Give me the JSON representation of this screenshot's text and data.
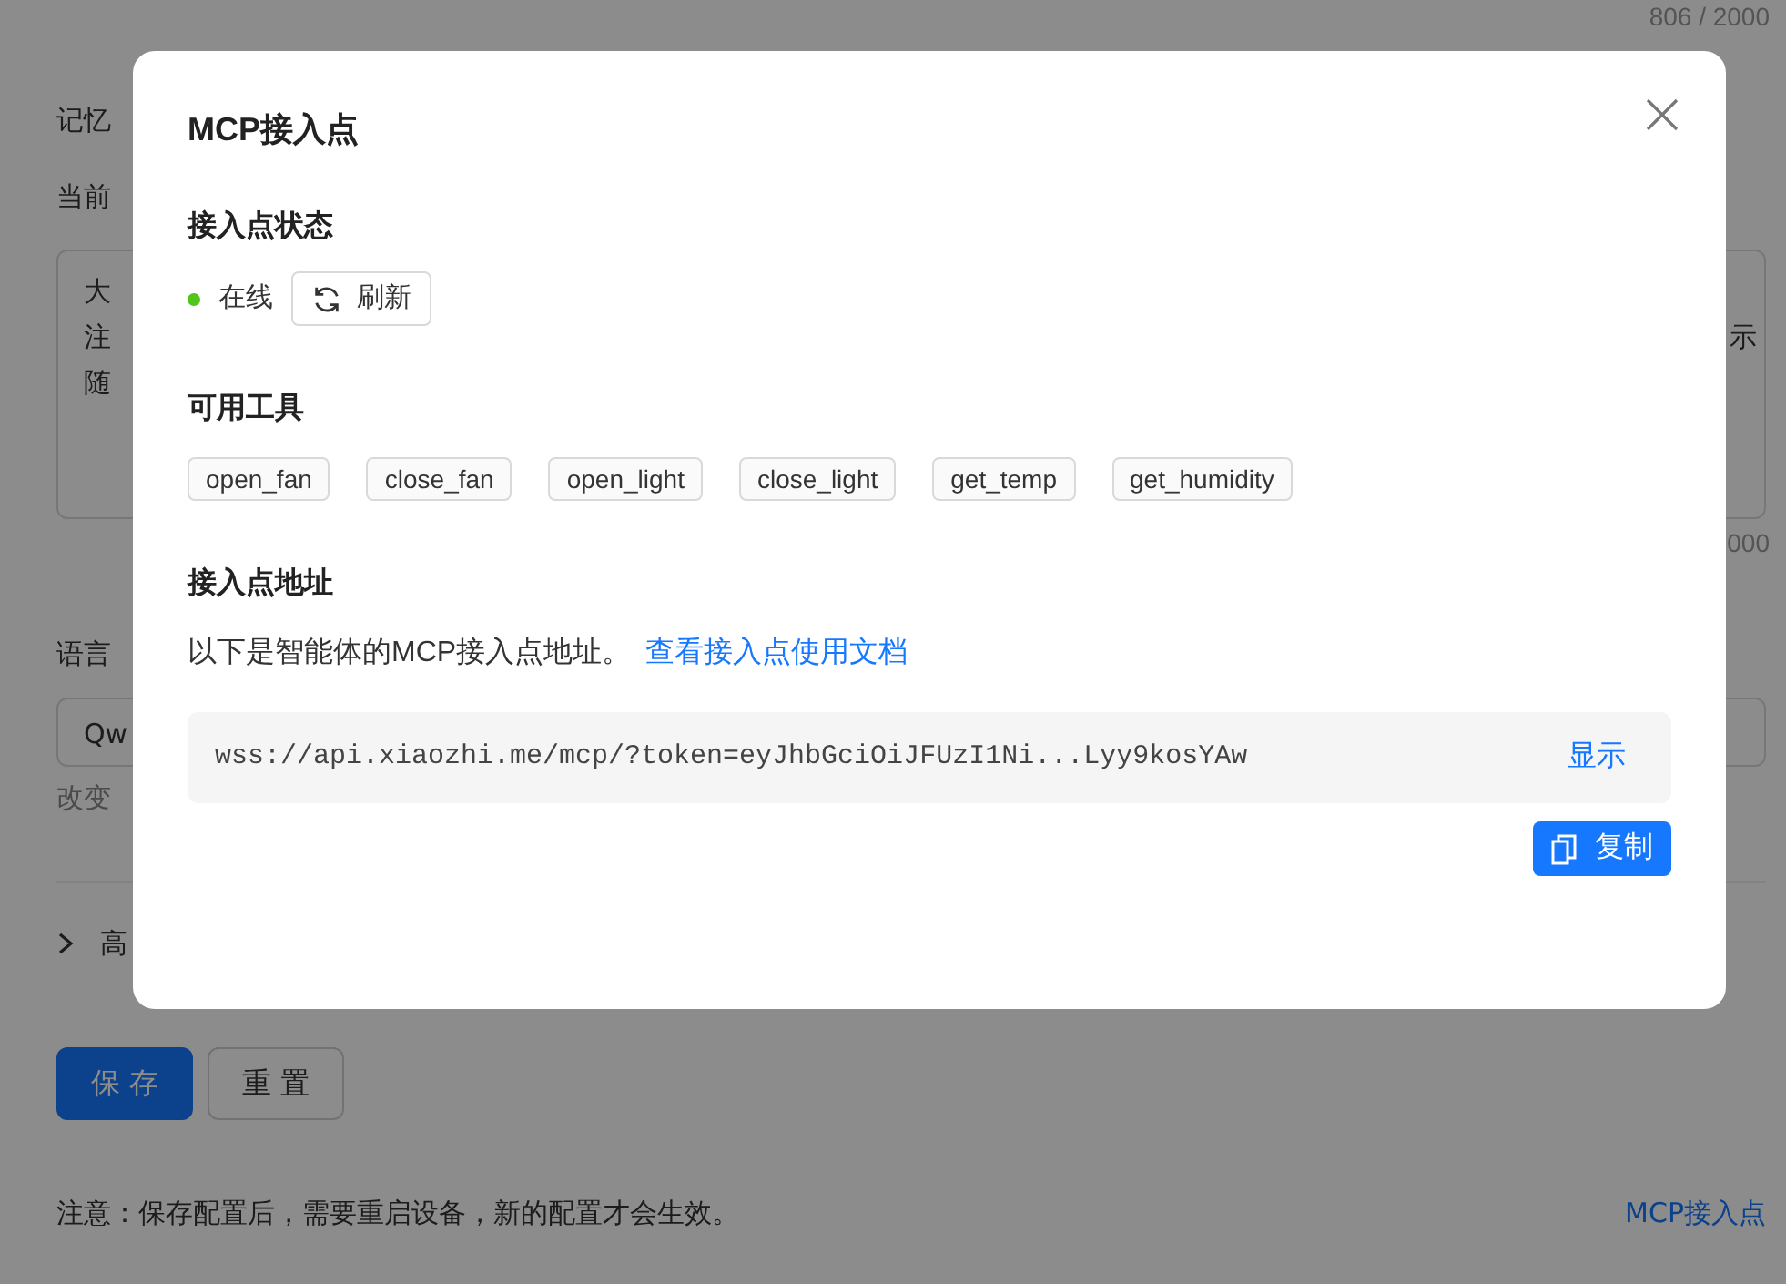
{
  "page": {
    "counter": "806 / 2000",
    "memory_label": "记忆",
    "current_label": "当前",
    "textarea_lines": [
      {
        "left": "大"
      },
      {
        "left": "注",
        "right": "示"
      },
      {
        "left": "随"
      }
    ],
    "textarea_counter": "000",
    "language_label": "语言",
    "select_value": "Qw",
    "select_hint": "改变",
    "advanced": {
      "label": "高",
      "expanded": false
    },
    "buttons": [
      {
        "label": "保 存",
        "kind": "primary"
      },
      {
        "label": "重 置",
        "kind": "secondary"
      }
    ],
    "note": "注意：保存配置后，需要重启设备，新的配置才会生效。",
    "mcp_link": "MCP接入点"
  },
  "dialog": {
    "title": "MCP接入点",
    "status_heading": "接入点状态",
    "status": {
      "label": "在线",
      "online": true
    },
    "refresh_button": "刷新",
    "tools_heading": "可用工具",
    "tools": [
      "open_fan",
      "close_fan",
      "open_light",
      "close_light",
      "get_temp",
      "get_humidity"
    ],
    "address_heading": "接入点地址",
    "address_intro": "以下是智能体的MCP接入点地址。",
    "docs_link": "查看接入点使用文档",
    "address": "wss://api.xiaozhi.me/mcp/?token=eyJhbGciOiJFUzI1Ni...Lyy9kosYAw",
    "show_button": "显示",
    "copy_button": "复制"
  }
}
